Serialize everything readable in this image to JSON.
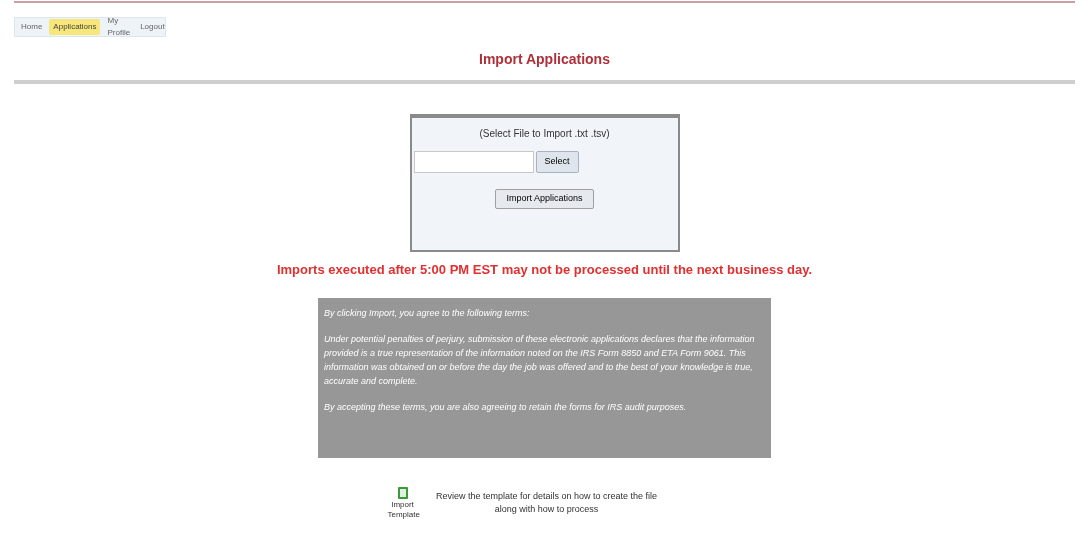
{
  "nav": [
    {
      "label": "Home",
      "selected": false
    },
    {
      "label": "Applications",
      "selected": true
    },
    {
      "label": "My Profile",
      "selected": false
    },
    {
      "label": "Logout",
      "selected": false
    }
  ],
  "title": "Import Applications",
  "import_box": {
    "label": "(Select File to Import .txt .tsv)",
    "select_button": "Select",
    "import_button": "Import Applications"
  },
  "warning": "Imports executed after 5:00 PM EST may not be processed until the next business day.",
  "terms": [
    "By clicking Import, you agree to the following terms:",
    "Under potential penalties of perjury, submission of these electronic applications declares that the information provided is a true representation of the information noted on the IRS Form 8850 and ETA Form 9061. This information was obtained on or before the day the job was offered and to the best of your knowledge is true, accurate and complete.",
    "By accepting these terms, you are also agreeing to retain the forms for IRS audit purposes."
  ],
  "template": {
    "link": "Import Template",
    "text": "Review the template for details on how to create the file along with how to process"
  }
}
